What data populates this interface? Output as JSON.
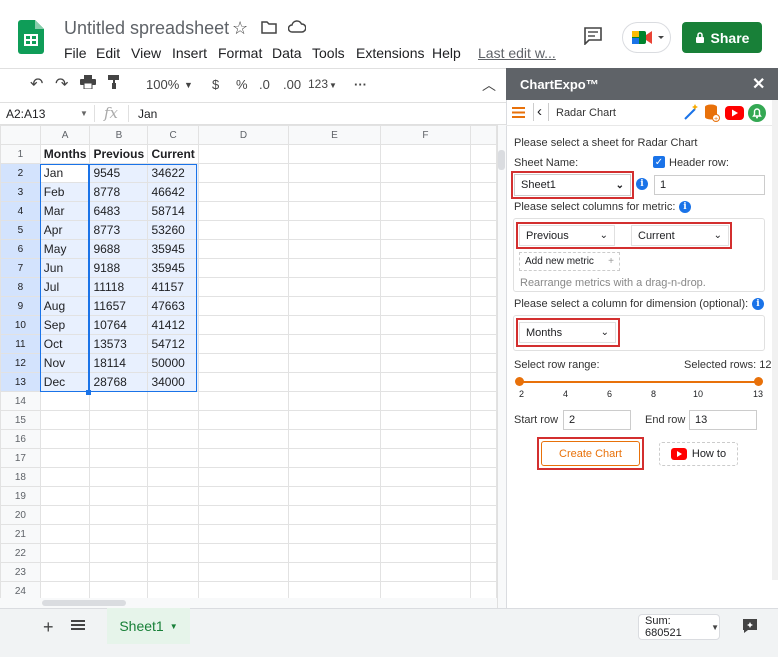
{
  "app": {
    "title": "Untitled spreadsheet",
    "menus": [
      "File",
      "Edit",
      "View",
      "Insert",
      "Format",
      "Data",
      "Tools",
      "Extensions",
      "Help"
    ],
    "last_edit": "Last edit w...",
    "share_label": "Share"
  },
  "toolbar": {
    "zoom": "100%",
    "currency": "$",
    "percent": "%",
    "dec_decrease": ".0",
    "dec_increase": ".00",
    "format_more": "123",
    "more": "···"
  },
  "formula_bar": {
    "name_box": "A2:A13",
    "value": "Jan"
  },
  "sheet": {
    "columns": [
      "A",
      "B",
      "C",
      "D",
      "E",
      "F"
    ],
    "rows": [
      [
        "Months",
        "Previous",
        "Current"
      ],
      [
        "Jan",
        "9545",
        "34622"
      ],
      [
        "Feb",
        "8778",
        "46642"
      ],
      [
        "Mar",
        "6483",
        "58714"
      ],
      [
        "Apr",
        "8773",
        "53260"
      ],
      [
        "May",
        "9688",
        "35945"
      ],
      [
        "Jun",
        "9188",
        "35945"
      ],
      [
        "Jul",
        "11118",
        "41157"
      ],
      [
        "Aug",
        "11657",
        "47663"
      ],
      [
        "Sep",
        "10764",
        "41412"
      ],
      [
        "Oct",
        "13573",
        "54712"
      ],
      [
        "Nov",
        "18114",
        "50000"
      ],
      [
        "Dec",
        "28768",
        "34000"
      ]
    ],
    "total_rows": 24
  },
  "bottom": {
    "sheet_tab": "Sheet1",
    "sum": "Sum: 680521"
  },
  "panel": {
    "title": "ChartExpo™",
    "close": "✕",
    "chart_type": "Radar Chart",
    "select_sheet_text": "Please select a sheet for Radar Chart",
    "sheet_name_label": "Sheet Name:",
    "header_row_label": "Header row:",
    "sheet_value": "Sheet1",
    "header_row_value": "1",
    "metric_label": "Please select columns for metric:",
    "metric1": "Previous",
    "metric2": "Current",
    "add_metric": "Add new metric",
    "rearrange_hint": "Rearrange metrics with a drag-n-drop.",
    "dimension_label": "Please select a column for dimension (optional):",
    "dimension_value": "Months",
    "row_range_label": "Select row range:",
    "selected_rows": "Selected rows: 12",
    "ticks": [
      "2",
      "4",
      "6",
      "8",
      "10",
      "13"
    ],
    "start_row_label": "Start row",
    "start_row_value": "2",
    "end_row_label": "End row",
    "end_row_value": "13",
    "create_chart": "Create Chart",
    "how_to": "How to"
  },
  "colors": {
    "accent_green": "#188038",
    "panel_header": "#5f6368",
    "orange": "#e8710a",
    "selection_blue": "#1a73e8",
    "red_outline": "#d32f2f"
  }
}
